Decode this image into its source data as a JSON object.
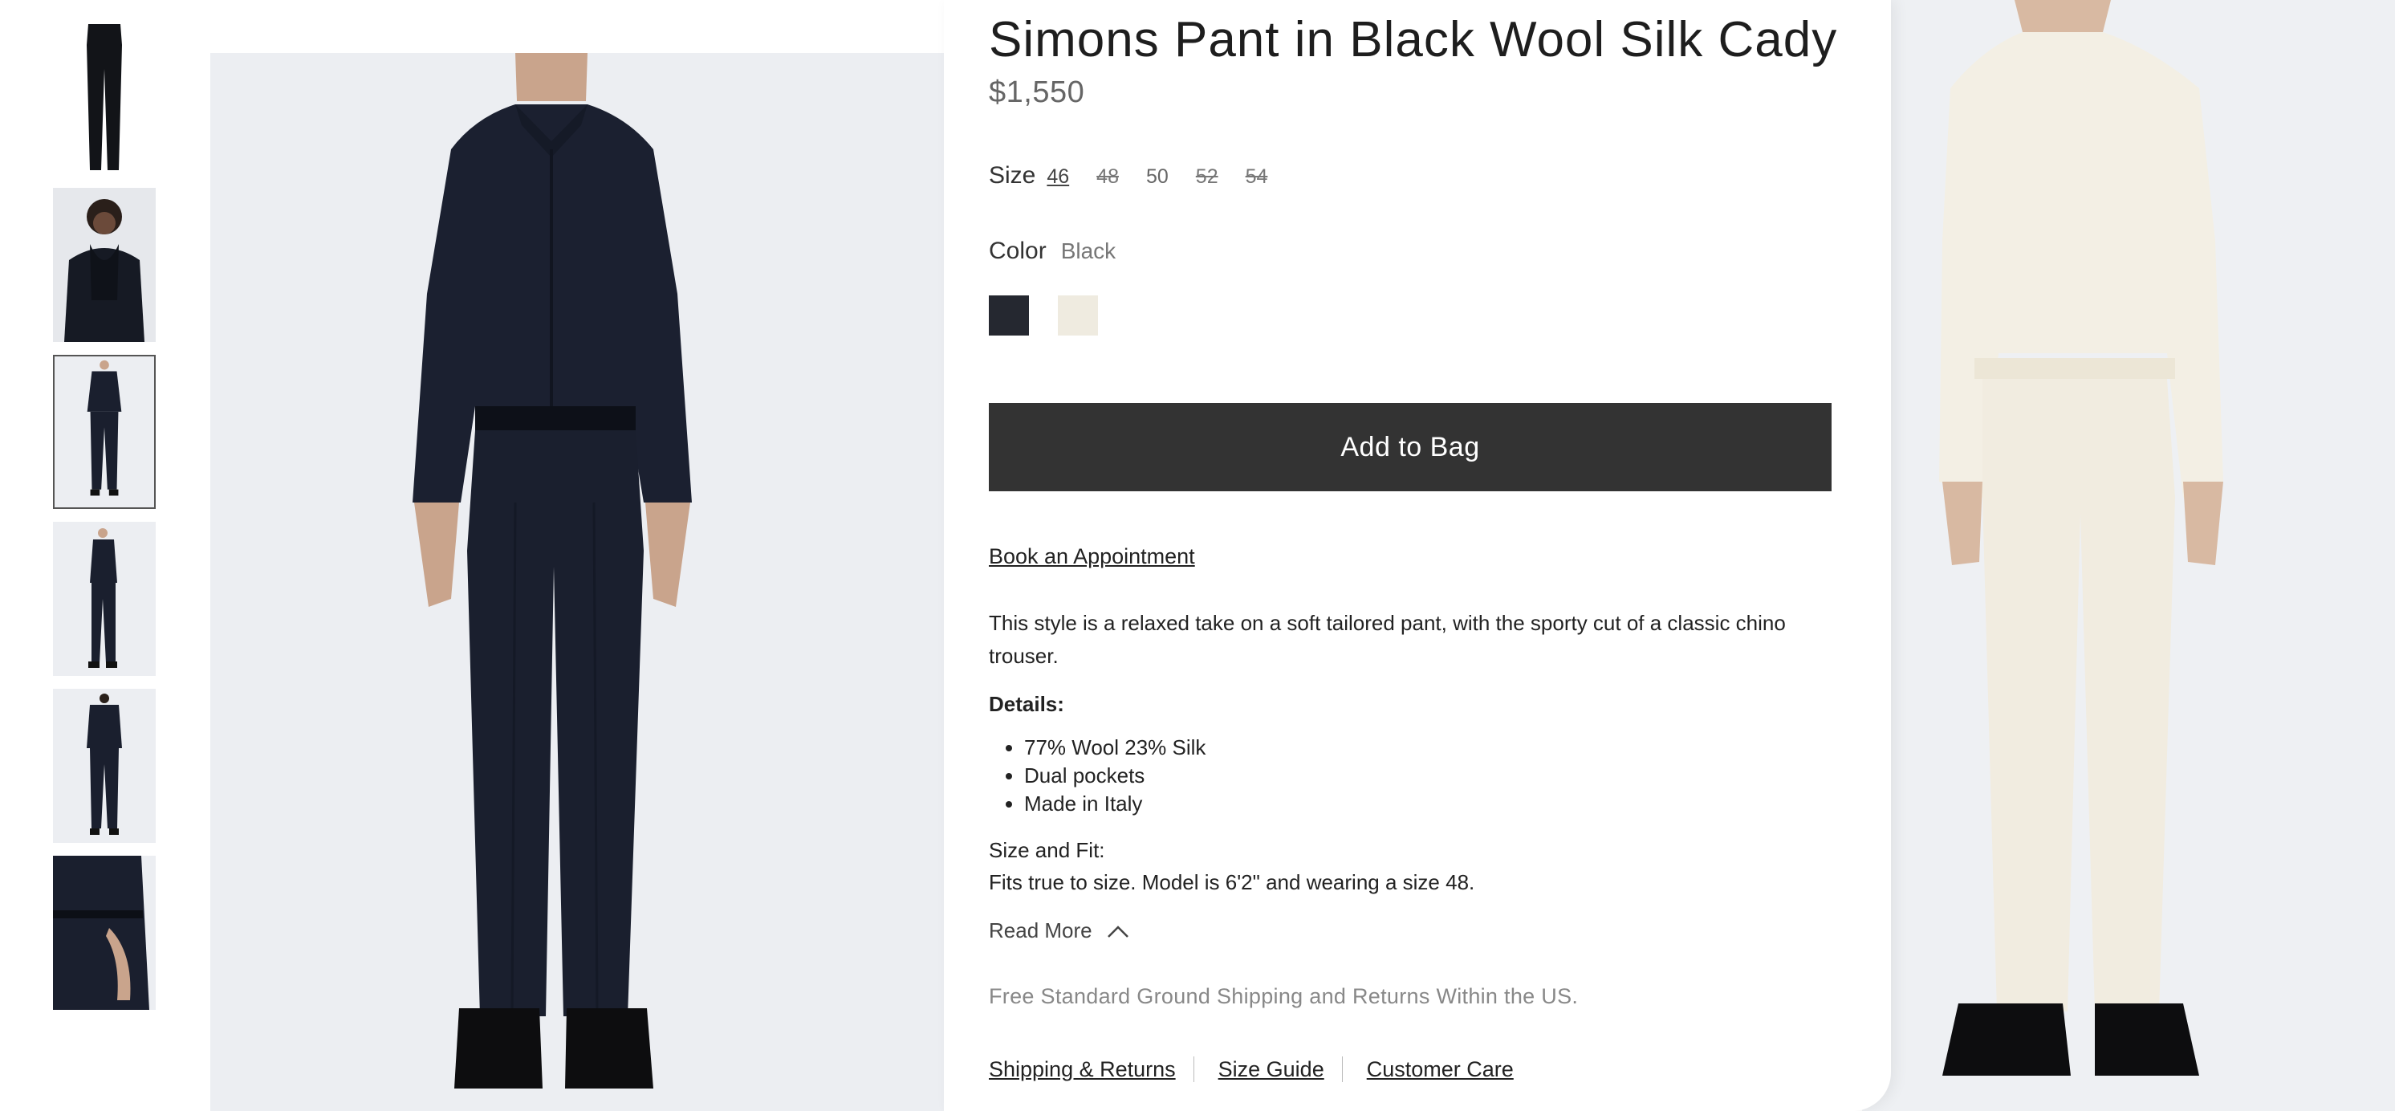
{
  "product": {
    "title": "Simons Pant in Black Wool Silk Cady",
    "price": "$1,550"
  },
  "size": {
    "label": "Size",
    "options": [
      {
        "label": "46",
        "state": "selected"
      },
      {
        "label": "48",
        "state": "unavailable"
      },
      {
        "label": "50",
        "state": "available"
      },
      {
        "label": "52",
        "state": "unavailable"
      },
      {
        "label": "54",
        "state": "unavailable"
      }
    ]
  },
  "color": {
    "label": "Color",
    "value": "Black",
    "swatches": [
      {
        "name": "black",
        "hex": "#252830"
      },
      {
        "name": "ivory",
        "hex": "#efebe0"
      }
    ]
  },
  "actions": {
    "add_to_bag": "Add to Bag",
    "book_appointment": "Book an Appointment"
  },
  "description": "This style is a relaxed take on a soft tailored pant, with the sporty cut of a classic chino trouser.",
  "details": {
    "heading": "Details:",
    "items": [
      "77% Wool 23% Silk",
      "Dual pockets",
      "Made in Italy"
    ]
  },
  "size_fit": {
    "heading": "Size and Fit:",
    "text": "Fits true to size. Model is 6'2\" and wearing a size 48."
  },
  "read_more": "Read More",
  "shipping_note": "Free Standard Ground Shipping and Returns Within the US.",
  "footer_links": [
    "Shipping & Returns",
    "Size Guide",
    "Customer Care"
  ],
  "thumbnails": {
    "count": 6,
    "selected_index": 2
  }
}
